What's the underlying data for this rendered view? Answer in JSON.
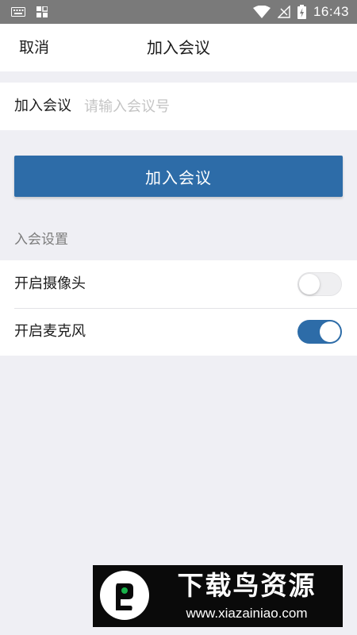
{
  "status_bar": {
    "time": "16:43",
    "left_icons": [
      "keyboard-icon",
      "grid-icon"
    ],
    "right_icons": [
      "wifi-icon",
      "no-signal-icon",
      "battery-charging-icon"
    ]
  },
  "header": {
    "cancel_label": "取消",
    "title": "加入会议"
  },
  "join_form": {
    "label": "加入会议",
    "placeholder": "请输入会议号",
    "value": ""
  },
  "join_button": {
    "label": "加入会议"
  },
  "settings": {
    "section_title": "入会设置",
    "items": [
      {
        "label": "开启摄像头",
        "enabled": false
      },
      {
        "label": "开启麦克风",
        "enabled": true
      }
    ]
  },
  "watermark": {
    "title": "下载鸟资源",
    "url": "www.xiazainiao.com"
  },
  "colors": {
    "accent": "#2d6ca8",
    "background": "#efeff4",
    "status_bar": "#7a7a7a"
  }
}
